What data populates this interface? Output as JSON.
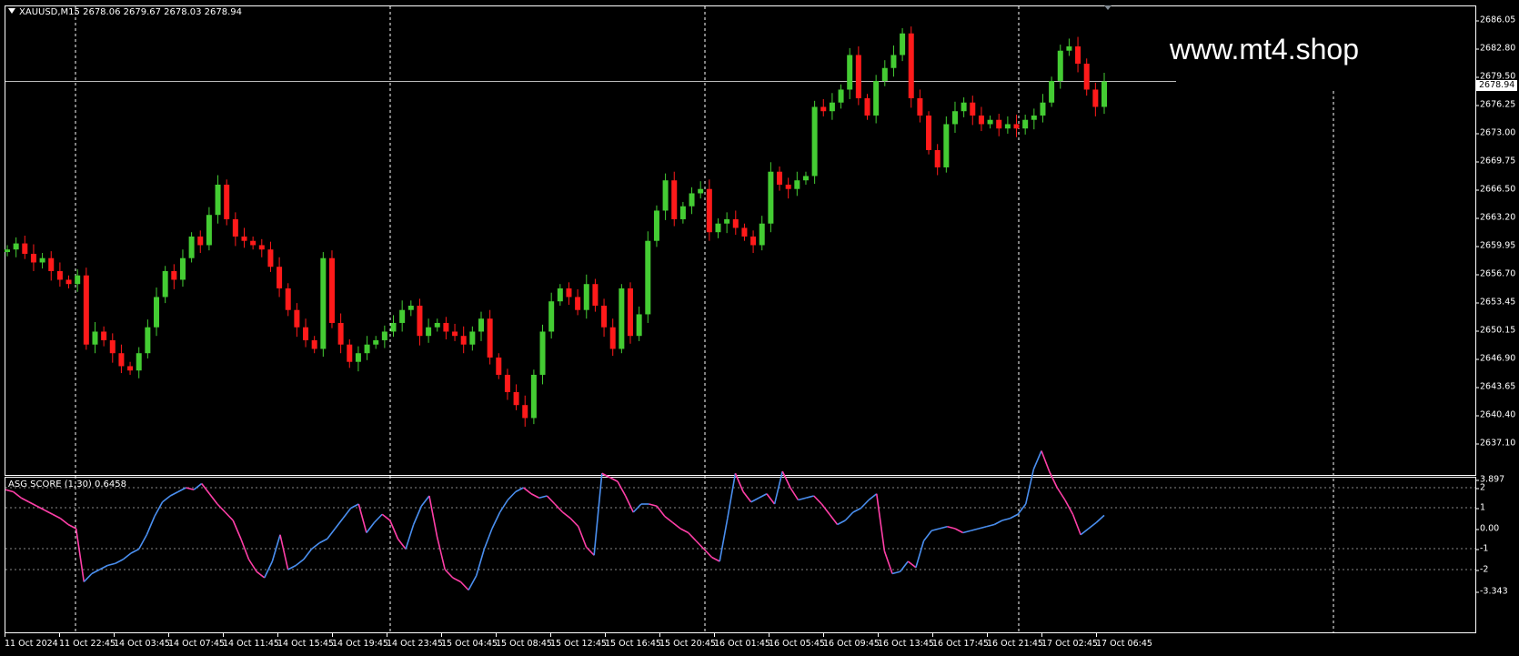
{
  "window": {
    "symbol_header": "XAUUSD,M15  2678.06 2679.67 2678.03 2678.94",
    "watermark": "www.mt4.shop"
  },
  "price_axis": {
    "labels": [
      "2686.05",
      "2682.80",
      "2679.50",
      "2676.25",
      "2673.00",
      "2669.75",
      "2666.50",
      "2663.20",
      "2659.95",
      "2656.70",
      "2653.45",
      "2650.15",
      "2646.90",
      "2643.65",
      "2640.40",
      "2637.10"
    ],
    "current_price": "2678.94"
  },
  "indicator": {
    "name": "ASG SCORE (1,30) 0.6458",
    "axis_labels": [
      "3.897",
      "2",
      "1",
      "0.00",
      "-1",
      "-2",
      "-3.343"
    ],
    "rise_color": "#4a8ff0",
    "fall_color": "#ff3fa8",
    "series": [
      1.9,
      1.8,
      1.5,
      1.3,
      1.1,
      0.9,
      0.7,
      0.5,
      0.2,
      0,
      -2.6,
      -2.2,
      -2.0,
      -1.8,
      -1.7,
      -1.5,
      -1.2,
      -1.0,
      -0.3,
      0.6,
      1.3,
      1.6,
      1.8,
      2.0,
      1.9,
      2.2,
      1.7,
      1.2,
      0.8,
      0.4,
      -0.5,
      -1.5,
      -2.1,
      -2.4,
      -1.6,
      -0.3,
      -2.0,
      -1.8,
      -1.5,
      -1.0,
      -0.7,
      -0.5,
      0.0,
      0.5,
      1.0,
      1.2,
      -0.2,
      0.3,
      0.7,
      0.4,
      -0.5,
      -1.0,
      0.2,
      1.1,
      1.6,
      -0.4,
      -2.0,
      -2.4,
      -2.6,
      -3.0,
      -2.3,
      -1.0,
      0.0,
      0.8,
      1.4,
      1.8,
      2.0,
      1.7,
      1.5,
      1.6,
      1.2,
      0.8,
      0.5,
      0.1,
      -0.9,
      -1.3,
      2.7,
      2.5,
      2.3,
      1.6,
      0.8,
      1.2,
      1.2,
      1.1,
      0.6,
      0.3,
      0.0,
      -0.2,
      -0.6,
      -1.0,
      -1.4,
      -1.6,
      0.5,
      2.7,
      1.8,
      1.3,
      1.5,
      1.7,
      1.2,
      2.8,
      2.0,
      1.4,
      1.5,
      1.6,
      1.2,
      0.7,
      0.2,
      0.4,
      0.8,
      1.0,
      1.4,
      1.7,
      -1.1,
      -2.2,
      -2.1,
      -1.6,
      -1.9,
      -0.6,
      -0.1,
      0.0,
      0.1,
      0.0,
      -0.2,
      -0.1,
      0.0,
      0.1,
      0.2,
      0.4,
      0.5,
      0.7,
      1.2,
      2.9,
      3.8,
      2.8,
      2.0,
      1.4,
      0.7,
      -0.3,
      0.0,
      0.3,
      0.65
    ]
  },
  "time_axis": {
    "labels": [
      "11 Oct 2024",
      "11 Oct 22:45",
      "14 Oct 03:45",
      "14 Oct 07:45",
      "14 Oct 11:45",
      "14 Oct 15:45",
      "14 Oct 19:45",
      "14 Oct 23:45",
      "15 Oct 04:45",
      "15 Oct 08:45",
      "15 Oct 12:45",
      "15 Oct 16:45",
      "15 Oct 20:45",
      "16 Oct 01:45",
      "16 Oct 05:45",
      "16 Oct 09:45",
      "16 Oct 13:45",
      "16 Oct 17:45",
      "16 Oct 21:45",
      "17 Oct 02:45",
      "17 Oct 06:45"
    ]
  },
  "chart_data": {
    "type": "candlestick",
    "ylim": [
      2637.1,
      2686.05
    ],
    "bull_color": "#44cc33",
    "bear_color": "#ff1a1a",
    "closes": [
      2659.5,
      2660.2,
      2659.0,
      2658.0,
      2658.5,
      2657.0,
      2656.0,
      2655.5,
      2656.5,
      2648.5,
      2650.0,
      2649.0,
      2647.5,
      2646.0,
      2645.5,
      2647.5,
      2650.5,
      2654.0,
      2657.0,
      2656.0,
      2658.5,
      2661.0,
      2660.0,
      2663.5,
      2667.0,
      2663.0,
      2661.0,
      2660.5,
      2660.0,
      2659.5,
      2657.5,
      2655.0,
      2652.5,
      2650.5,
      2649.0,
      2648.0,
      2658.5,
      2651.0,
      2648.5,
      2646.5,
      2647.5,
      2648.5,
      2649.0,
      2650.0,
      2651.0,
      2652.5,
      2653.0,
      2649.5,
      2650.5,
      2651.0,
      2650.0,
      2649.5,
      2648.5,
      2650.0,
      2651.5,
      2647.0,
      2645.0,
      2643.0,
      2641.5,
      2640.0,
      2645.0,
      2650.0,
      2653.5,
      2655.0,
      2654.0,
      2652.5,
      2655.5,
      2653.0,
      2650.5,
      2648.0,
      2655.0,
      2649.5,
      2652.0,
      2660.5,
      2664.0,
      2667.5,
      2663.0,
      2664.5,
      2666.0,
      2666.5,
      2661.5,
      2662.5,
      2663.0,
      2662.0,
      2661.0,
      2660.0,
      2662.5,
      2668.5,
      2667.0,
      2666.5,
      2667.5,
      2668.0,
      2676.0,
      2675.5,
      2676.5,
      2678.0,
      2682.0,
      2677.0,
      2675.0,
      2679.0,
      2680.5,
      2682.0,
      2684.5,
      2677.0,
      2675.0,
      2671.0,
      2669.0,
      2674.0,
      2675.5,
      2676.5,
      2675.0,
      2674.0,
      2674.5,
      2673.5,
      2674.0,
      2673.5,
      2674.5,
      2675.0,
      2676.5,
      2679.0,
      2682.5,
      2683.0,
      2681.0,
      2678.0,
      2676.0,
      2678.94
    ]
  }
}
